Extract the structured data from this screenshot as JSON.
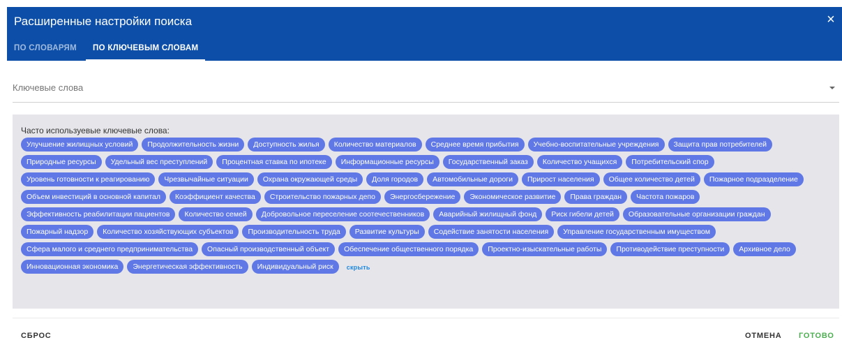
{
  "dialog": {
    "title": "Расширенные настройки поиска",
    "close_icon": "×",
    "tabs": [
      {
        "label": "ПО СЛОВАРЯМ",
        "active": false
      },
      {
        "label": "ПО КЛЮЧЕВЫМ СЛОВАМ",
        "active": true
      }
    ]
  },
  "keywords_field": {
    "placeholder": "Ключевые слова"
  },
  "frequent": {
    "label": "Часто используевые ключевые слова:",
    "chips": [
      "Улучшение жилищных условий",
      "Продолжительность жизни",
      "Доступность жилья",
      "Количество материалов",
      "Среднее время прибытия",
      "Учебно-воспитательные учреждения",
      "Защита прав потребителей",
      "Природные ресурсы",
      "Удельный вес преступлений",
      "Процентная ставка по ипотеке",
      "Информационные ресурсы",
      "Государственный заказ",
      "Количество учащихся",
      "Потребительский спор",
      "Уровень готовности к реагированию",
      "Чрезвычайные ситуации",
      "Охрана окружающей среды",
      "Доля городов",
      "Автомобильные дороги",
      "Прирост населения",
      "Общее количество детей",
      "Пожарное подразделение",
      "Объем инвестиций в основной капитал",
      "Коэффициент качества",
      "Строительство пожарных депо",
      "Энергосбережение",
      "Экономическое развитие",
      "Права граждан",
      "Частота пожаров",
      "Эффективность реабилитации пациентов",
      "Количество семей",
      "Добровольное переселение соотечественников",
      "Аварийный жилищный фонд",
      "Риск гибели детей",
      "Образовательные организации граждан",
      "Пожарный надзор",
      "Количество хозяйствующих субъектов",
      "Производительность труда",
      "Развитие культуры",
      "Содействие занятости населения",
      "Управление государственным имуществом",
      "Сфера малого и среднего предпринимательства",
      "Опасный производственный объект",
      "Обеспечение общественного порядка",
      "Проектно-изыскательные работы",
      "Противодействие преступности",
      "Архивное дело",
      "Инновационная экономика",
      "Энергетическая эффективность",
      "Индивидуальный риск"
    ],
    "hide_label": "скрыть"
  },
  "footer": {
    "reset": "СБРОС",
    "cancel": "ОТМЕНА",
    "done": "ГОТОВО"
  },
  "colors": {
    "header": "#0d4fa8",
    "chip": "#5f78e6",
    "done": "#4caf50",
    "link": "#1e88e5"
  }
}
